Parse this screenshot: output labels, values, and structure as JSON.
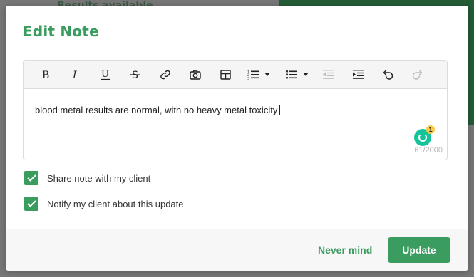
{
  "background": {
    "partial_heading": "Results available"
  },
  "modal": {
    "title": "Edit Note"
  },
  "toolbar": {
    "buttons": [
      {
        "name": "bold-icon"
      },
      {
        "name": "italic-icon"
      },
      {
        "name": "underline-icon"
      },
      {
        "name": "strikethrough-icon"
      },
      {
        "name": "link-icon"
      },
      {
        "name": "camera-icon"
      },
      {
        "name": "table-icon"
      },
      {
        "name": "numbered-list-icon"
      },
      {
        "name": "bulleted-list-icon"
      },
      {
        "name": "outdent-icon"
      },
      {
        "name": "indent-icon"
      },
      {
        "name": "undo-icon"
      },
      {
        "name": "redo-icon"
      }
    ]
  },
  "editor": {
    "content": "blood metal results are normal, with no heavy metal toxicity",
    "char_count": "61/2000",
    "grammar_badge": "1"
  },
  "options": {
    "share_label": "Share note with my client",
    "share_checked": true,
    "notify_label": "Notify my client about this update",
    "notify_checked": true
  },
  "footer": {
    "cancel_label": "Never mind",
    "submit_label": "Update"
  },
  "colors": {
    "accent": "#3a9c5f",
    "grammarly": "#15c39a"
  }
}
